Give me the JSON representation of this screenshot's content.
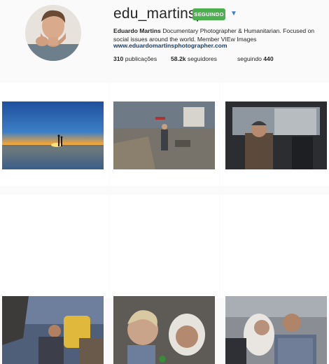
{
  "profile": {
    "username": "edu_martinsp",
    "follow_button_label": "SEGUINDO",
    "dropdown_icon": "caret-down-icon",
    "full_name": "Eduardo Martins",
    "bio": " Documentary Photographer & Humanitarian. Focused on social issues around the world. Member VIEw Images",
    "website": "www.eduardomartinsphotographer.com"
  },
  "stats": {
    "posts_count": "310",
    "posts_label": " publicações",
    "followers_count": "58.2k",
    "followers_label": " seguidores",
    "following_label": "seguindo ",
    "following_count": "440"
  },
  "colors": {
    "follow_button": "#4caf50",
    "link": "#1c3e66",
    "dropdown": "#3b82c4"
  }
}
